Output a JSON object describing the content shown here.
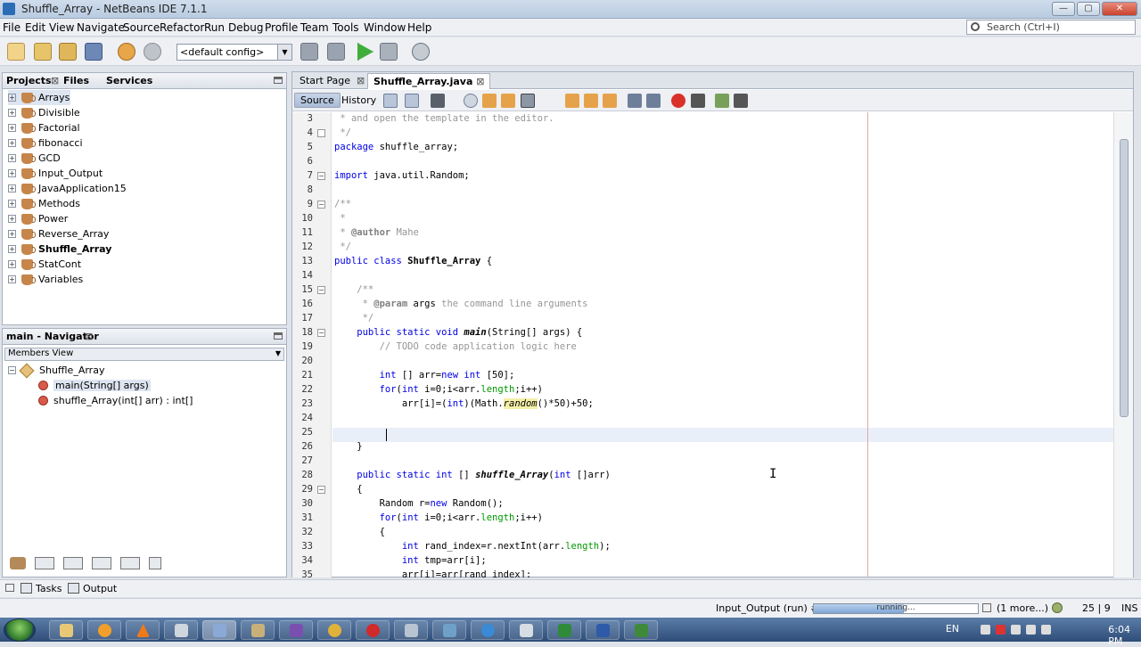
{
  "window": {
    "title": "Shuffle_Array - NetBeans IDE 7.1.1",
    "min": "—",
    "max": "▢",
    "close": "✕"
  },
  "menu": [
    "File",
    "Edit",
    "View",
    "Navigate",
    "Source",
    "Refactor",
    "Run",
    "Debug",
    "Profile",
    "Team",
    "Tools",
    "Window",
    "Help"
  ],
  "search": {
    "placeholder": "Search (Ctrl+I)"
  },
  "toolbar": {
    "config": "<default config>"
  },
  "projects_panel": {
    "tabs": [
      "Projects",
      "Files",
      "Services"
    ],
    "tab_close": "⊠",
    "items": [
      "Arrays",
      "Divisible",
      "Factorial",
      "fibonacci",
      "GCD",
      "Input_Output",
      "JavaApplication15",
      "Methods",
      "Power",
      "Reverse_Array",
      "Shuffle_Array",
      "StatCont",
      "Variables"
    ],
    "selected": "Arrays",
    "bold": "Shuffle_Array"
  },
  "navigator": {
    "title": "main - Navigator",
    "close": "⊠",
    "view": "Members View",
    "class": "Shuffle_Array",
    "members": [
      "main(String[] args)",
      "shuffle_Array(int[] arr) : int[]"
    ]
  },
  "editor": {
    "tabs": [
      "Start Page",
      "Shuffle_Array.java"
    ],
    "tab_close": "⊠",
    "source_label": "Source",
    "history_label": "History",
    "line_numbers": [
      "3",
      "4",
      "5",
      "6",
      "7",
      "8",
      "9",
      "10",
      "11",
      "12",
      "13",
      "14",
      "15",
      "16",
      "17",
      "18",
      "19",
      "20",
      "21",
      "22",
      "23",
      "24",
      "25",
      "26",
      "27",
      "28",
      "29",
      "30",
      "31",
      "32",
      "33",
      "34",
      "35"
    ],
    "lines": {
      "l3": " * and open the template in the editor.",
      "l4": " */",
      "l5_kw": "package",
      "l5_rest": " shuffle_array;",
      "l7_kw": "import",
      "l7_rest": " java.util.Random;",
      "l9": "/**",
      "l10": " *",
      "l11_a": " * ",
      "l11_tag": "@author",
      "l11_b": " Mahe",
      "l12": " */",
      "l13_kw": "public class",
      "l13_name": " Shuffle_Array",
      "l13_rest": " {",
      "l15": "    /**",
      "l16_a": "     * ",
      "l16_tag": "@param",
      "l16_name": " args",
      "l16_b": " the command line arguments",
      "l17": "     */",
      "l18_kw": "    public static void",
      "l18_name": " main",
      "l18_rest": "(String[] args) {",
      "l19": "        // TODO code application logic here",
      "l21_kw": "        int",
      "l21_a": " [] arr=",
      "l21_kw2": "new int",
      "l21_b": " [50];",
      "l22_kw": "        for",
      "l22_a": "(",
      "l22_kw2": "int",
      "l22_b": " i=0;i<arr.",
      "l22_len": "length",
      "l22_c": ";i++)",
      "l23_a": "            arr[i]=(",
      "l23_kw": "int",
      "l23_b": ")(Math.",
      "l23_rand": "random",
      "l23_c": "()*50)+50;",
      "l26": "    }",
      "l28_kw": "    public static int",
      "l28_a": " [] ",
      "l28_name": "shuffle_Array",
      "l28_b": "(",
      "l28_kw2": "int",
      "l28_c": " []arr)",
      "l29": "    {",
      "l30_a": "        Random r=",
      "l30_kw": "new",
      "l30_b": " Random();",
      "l31_kw": "        for",
      "l31_a": "(",
      "l31_kw2": "int",
      "l31_b": " i=0;i<arr.",
      "l31_len": "length",
      "l31_c": ";i++)",
      "l32": "        {",
      "l33_kw": "            int",
      "l33_a": " rand_index=r.nextInt(arr.",
      "l33_len": "length",
      "l33_b": ");",
      "l34_kw": "            int",
      "l34_a": " tmp=arr[i];",
      "l35": "            arr[i]=arr[rand_index];"
    }
  },
  "bottom": {
    "tasks": "Tasks",
    "output": "Output"
  },
  "status": {
    "run": "Input_Output (run) #2",
    "running": "running...",
    "more": "(1 more...)",
    "position": "25 | 9",
    "mode": "INS",
    "progress": 0.55
  },
  "taskbar": {
    "lang": "EN",
    "time": "6:04 PM"
  },
  "colors": {
    "keyword": "#0000e6",
    "comment": "#969696",
    "field": "#009900",
    "highlight": "#f4f0a8"
  }
}
